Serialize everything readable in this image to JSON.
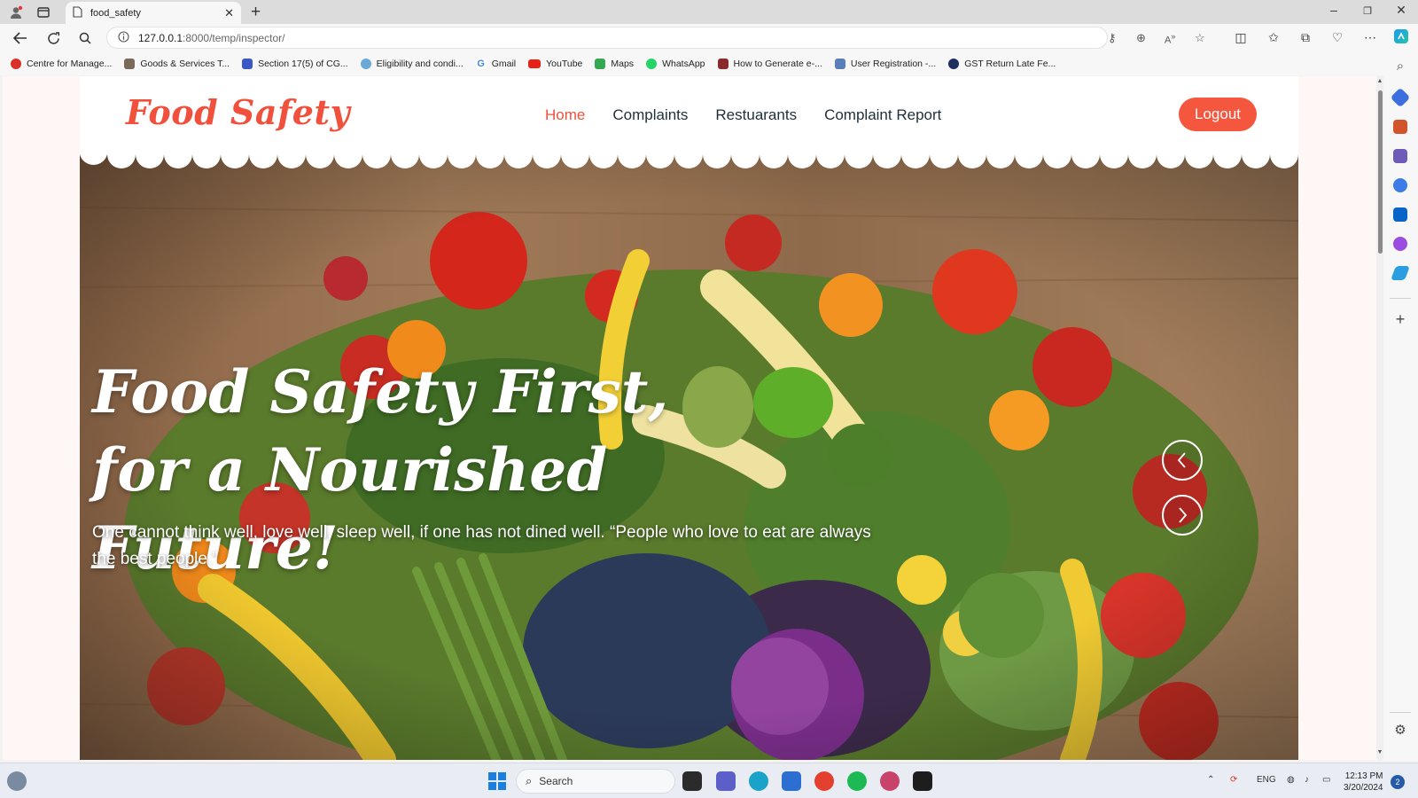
{
  "browser": {
    "tab_title": "food_safety",
    "url_host": "127.0.0.1",
    "url_path": ":8000/temp/inspector/"
  },
  "bookmarks": [
    {
      "label": "Centre for Manage...",
      "color": "#d9302a"
    },
    {
      "label": "Goods & Services T...",
      "color": "#7a6a5a"
    },
    {
      "label": "Section 17(5) of CG...",
      "color": "#3a57c6"
    },
    {
      "label": "Eligibility and condi...",
      "color": "#6aa8d8"
    },
    {
      "label": "Gmail",
      "color": "#4285f4"
    },
    {
      "label": "YouTube",
      "color": "#e62117"
    },
    {
      "label": "Maps",
      "color": "#34a853"
    },
    {
      "label": "WhatsApp",
      "color": "#25d366"
    },
    {
      "label": "How to Generate e-...",
      "color": "#8a2a2a"
    },
    {
      "label": "User Registration -...",
      "color": "#5a7fb8"
    },
    {
      "label": "GST Return Late Fe...",
      "color": "#1c2f5e"
    }
  ],
  "site": {
    "logo": "Food Safety",
    "nav": [
      {
        "label": "Home",
        "active": true
      },
      {
        "label": "Complaints",
        "active": false
      },
      {
        "label": "Restuarants",
        "active": false
      },
      {
        "label": "Complaint Report",
        "active": false
      }
    ],
    "logout_label": "Logout",
    "accent_color": "#f0503c"
  },
  "hero": {
    "title": "Food Safety First, for a Nourished Future!",
    "text": "One cannot think well, love well, sleep well, if one has not dined well. “People who love to eat are always the best people.”",
    "prev_glyph": "‹",
    "next_glyph": "›"
  },
  "taskbar": {
    "search_placeholder": "Search",
    "lang": "ENG",
    "time": "12:13 PM",
    "date": "3/20/2024",
    "notification_count": "2"
  }
}
